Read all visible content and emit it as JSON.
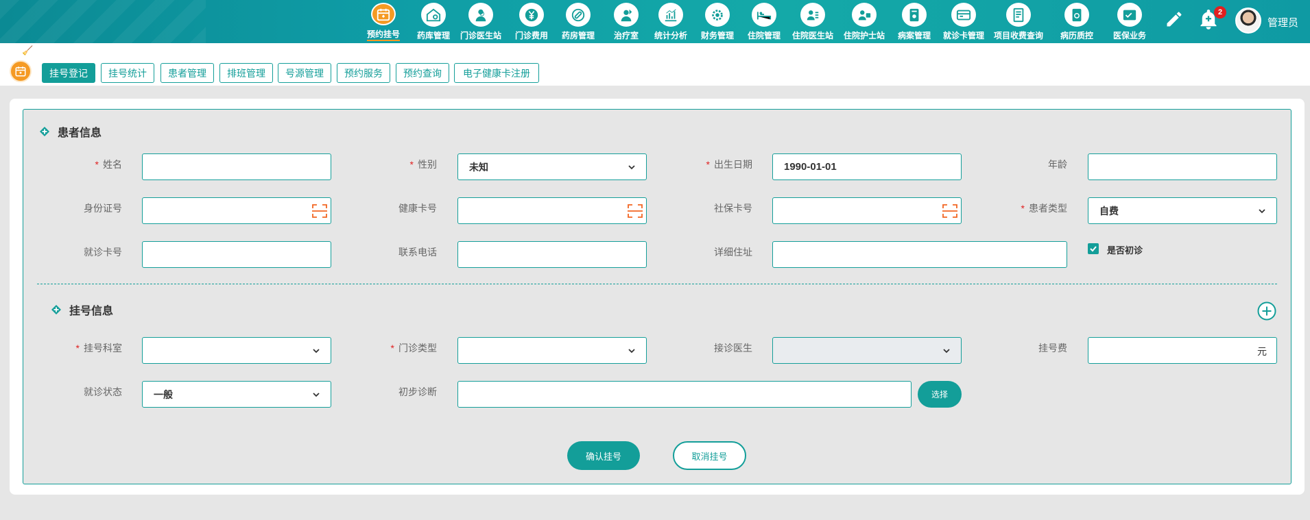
{
  "nav": {
    "items": [
      {
        "label": "预约挂号",
        "icon": "calendar-icon",
        "active": true
      },
      {
        "label": "药库管理",
        "icon": "warehouse-icon"
      },
      {
        "label": "门诊医生站",
        "icon": "doctor-icon"
      },
      {
        "label": "门诊费用",
        "icon": "yuan-icon"
      },
      {
        "label": "药房管理",
        "icon": "pill-icon"
      },
      {
        "label": "治疗室",
        "icon": "nurse-icon"
      },
      {
        "label": "统计分析",
        "icon": "bar-chart-icon"
      },
      {
        "label": "财务管理",
        "icon": "gear-icon"
      },
      {
        "label": "住院管理",
        "icon": "bed-icon"
      },
      {
        "label": "住院医生站",
        "icon": "doctor-id-icon"
      },
      {
        "label": "住院护士站",
        "icon": "nurse-id-icon"
      },
      {
        "label": "病案管理",
        "icon": "file-icon"
      },
      {
        "label": "就诊卡管理",
        "icon": "card-icon"
      },
      {
        "label": "项目收费查询",
        "icon": "receipt-icon"
      },
      {
        "label": "病历质控",
        "icon": "record-icon"
      },
      {
        "label": "医保业务",
        "icon": "insurance-icon"
      }
    ],
    "notification_count": "2",
    "username": "管理员"
  },
  "tabs": [
    {
      "label": "挂号登记",
      "active": true
    },
    {
      "label": "挂号统计"
    },
    {
      "label": "患者管理"
    },
    {
      "label": "排班管理"
    },
    {
      "label": "号源管理"
    },
    {
      "label": "预约服务"
    },
    {
      "label": "预约查询"
    },
    {
      "label": "电子健康卡注册"
    }
  ],
  "patient": {
    "title": "患者信息",
    "name_label": "姓名",
    "gender_label": "性别",
    "gender_value": "未知",
    "birth_label": "出生日期",
    "birth_value": "1990-01-01",
    "age_label": "年龄",
    "id_label": "身份证号",
    "health_card_label": "健康卡号",
    "social_card_label": "社保卡号",
    "type_label": "患者类型",
    "type_value": "自费",
    "visit_card_label": "就诊卡号",
    "phone_label": "联系电话",
    "address_label": "详细住址",
    "first_visit_label": "是否初诊",
    "first_visit_checked": true
  },
  "registration": {
    "title": "挂号信息",
    "dept_label": "挂号科室",
    "clinic_type_label": "门诊类型",
    "doctor_label": "接诊医生",
    "fee_label": "挂号费",
    "fee_unit": "元",
    "status_label": "就诊状态",
    "status_value": "一般",
    "diagnosis_label": "初步诊断",
    "choose_label": "选择",
    "required_mark": "*"
  },
  "actions": {
    "confirm_label": "确认挂号",
    "cancel_label": "取消挂号"
  },
  "colors": {
    "primary": "#139e99",
    "accent": "#f59a23",
    "required": "#e02020"
  }
}
